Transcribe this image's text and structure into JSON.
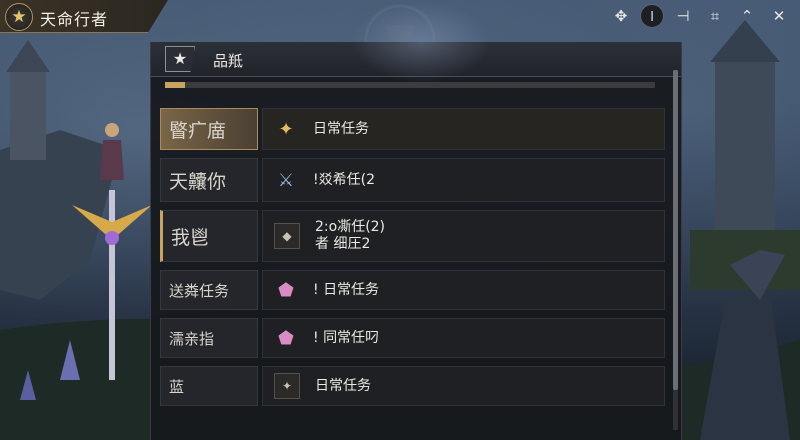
{
  "window": {
    "title": "天命行者",
    "star_icon": "star-icon"
  },
  "controls": [
    {
      "name": "move-icon",
      "glyph": "✥"
    },
    {
      "name": "info-icon",
      "glyph": "⏽"
    },
    {
      "name": "pin-icon",
      "glyph": "⊣"
    },
    {
      "name": "crop-icon",
      "glyph": "⌗"
    },
    {
      "name": "collapse-icon",
      "glyph": "⌃"
    },
    {
      "name": "close-icon",
      "glyph": "✕"
    }
  ],
  "panel": {
    "title": "品羝",
    "progress": 0.04,
    "rows": [
      {
        "label": "睯疒庿",
        "text": "日常任务",
        "icon": "gold-star-icon"
      },
      {
        "label": "天齉你",
        "text": "!㸚希任(2",
        "icon": "blue-scroll-icon"
      },
      {
        "label": "我鬯",
        "text_line1": "2:o凘任(2)",
        "text_line2": "者 细圧2",
        "icon": "dark-token-icon"
      },
      {
        "label": "送粦任务",
        "text": "! 日常任务",
        "icon": "pink-gem-icon"
      },
      {
        "label": "濡亲指",
        "text": "! 同常任叼",
        "icon": "pink-gem-icon"
      },
      {
        "label": "蓝",
        "text": "日常任务",
        "icon": "dark-star-icon"
      }
    ]
  },
  "colors": {
    "accent": "#c9a461",
    "panel_bg": "#16181c",
    "gem": "#d98bc4"
  }
}
